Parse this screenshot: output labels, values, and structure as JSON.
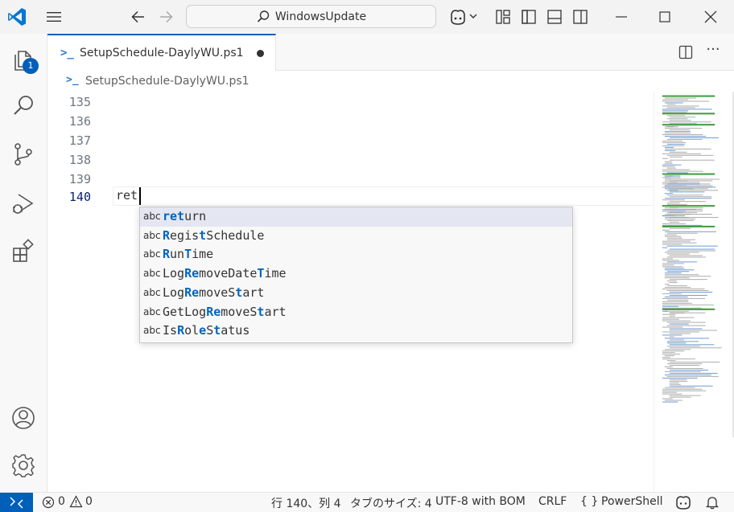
{
  "titlebar": {
    "search_text": "WindowsUpdate",
    "accent": "#005fb8",
    "vscode_blue": "#0065a9"
  },
  "activitybar": {
    "items": [
      {
        "name": "explorer",
        "icon": "files-icon",
        "badge": "1"
      },
      {
        "name": "search",
        "icon": "search-icon"
      },
      {
        "name": "source-control",
        "icon": "source-control-icon"
      },
      {
        "name": "run-and-debug",
        "icon": "run-debug-icon"
      },
      {
        "name": "extensions",
        "icon": "extensions-icon"
      }
    ],
    "bottom": [
      {
        "name": "accounts",
        "icon": "account-icon"
      },
      {
        "name": "manage",
        "icon": "gear-icon"
      }
    ]
  },
  "tabs": [
    {
      "label": "SetupSchedule-DaylyWU.ps1",
      "icon_glyph": ">_",
      "modified": true
    }
  ],
  "breadcrumb": {
    "icon_glyph": ">_",
    "label": "SetupSchedule-DaylyWU.ps1"
  },
  "editor": {
    "lines": [
      {
        "number": "135",
        "text": ""
      },
      {
        "number": "136",
        "text": ""
      },
      {
        "number": "137",
        "text": ""
      },
      {
        "number": "138",
        "text": ""
      },
      {
        "number": "139",
        "text": ""
      },
      {
        "number": "140",
        "text": "ret"
      }
    ],
    "active_line": "140"
  },
  "suggest": {
    "items": [
      {
        "kind": "abc",
        "parts": [
          {
            "t": "ret",
            "m": true
          },
          {
            "t": "urn",
            "m": false
          }
        ]
      },
      {
        "kind": "abc",
        "parts": [
          {
            "t": "R",
            "m": true
          },
          {
            "t": "egis",
            "m": false
          },
          {
            "t": "t",
            "m": true
          },
          {
            "t": "Schedule",
            "m": false
          }
        ]
      },
      {
        "kind": "abc",
        "parts": [
          {
            "t": "R",
            "m": true
          },
          {
            "t": "un",
            "m": false
          },
          {
            "t": "T",
            "m": true
          },
          {
            "t": "ime",
            "m": false
          }
        ]
      },
      {
        "kind": "abc",
        "parts": [
          {
            "t": "Log",
            "m": false
          },
          {
            "t": "Re",
            "m": true
          },
          {
            "t": "moveDate",
            "m": false
          },
          {
            "t": "T",
            "m": true
          },
          {
            "t": "ime",
            "m": false
          }
        ]
      },
      {
        "kind": "abc",
        "parts": [
          {
            "t": "Log",
            "m": false
          },
          {
            "t": "Re",
            "m": true
          },
          {
            "t": "moveS",
            "m": false
          },
          {
            "t": "t",
            "m": true
          },
          {
            "t": "art",
            "m": false
          }
        ]
      },
      {
        "kind": "abc",
        "parts": [
          {
            "t": "GetLog",
            "m": false
          },
          {
            "t": "Re",
            "m": true
          },
          {
            "t": "moveS",
            "m": false
          },
          {
            "t": "t",
            "m": true
          },
          {
            "t": "art",
            "m": false
          }
        ]
      },
      {
        "kind": "abc",
        "parts": [
          {
            "t": "Is",
            "m": false
          },
          {
            "t": "R",
            "m": true
          },
          {
            "t": "ol",
            "m": false
          },
          {
            "t": "e",
            "m": true
          },
          {
            "t": "S",
            "m": false
          },
          {
            "t": "t",
            "m": true
          },
          {
            "t": "atus",
            "m": false
          }
        ]
      }
    ],
    "selected_index": 0
  },
  "statusbar": {
    "errors": "0",
    "warnings": "0",
    "position": "行 140、列 4",
    "tab_size": "タブのサイズ: 4",
    "encoding": "UTF-8 with BOM",
    "eol": "CRLF",
    "language_braces": "{ }",
    "language": "PowerShell"
  }
}
